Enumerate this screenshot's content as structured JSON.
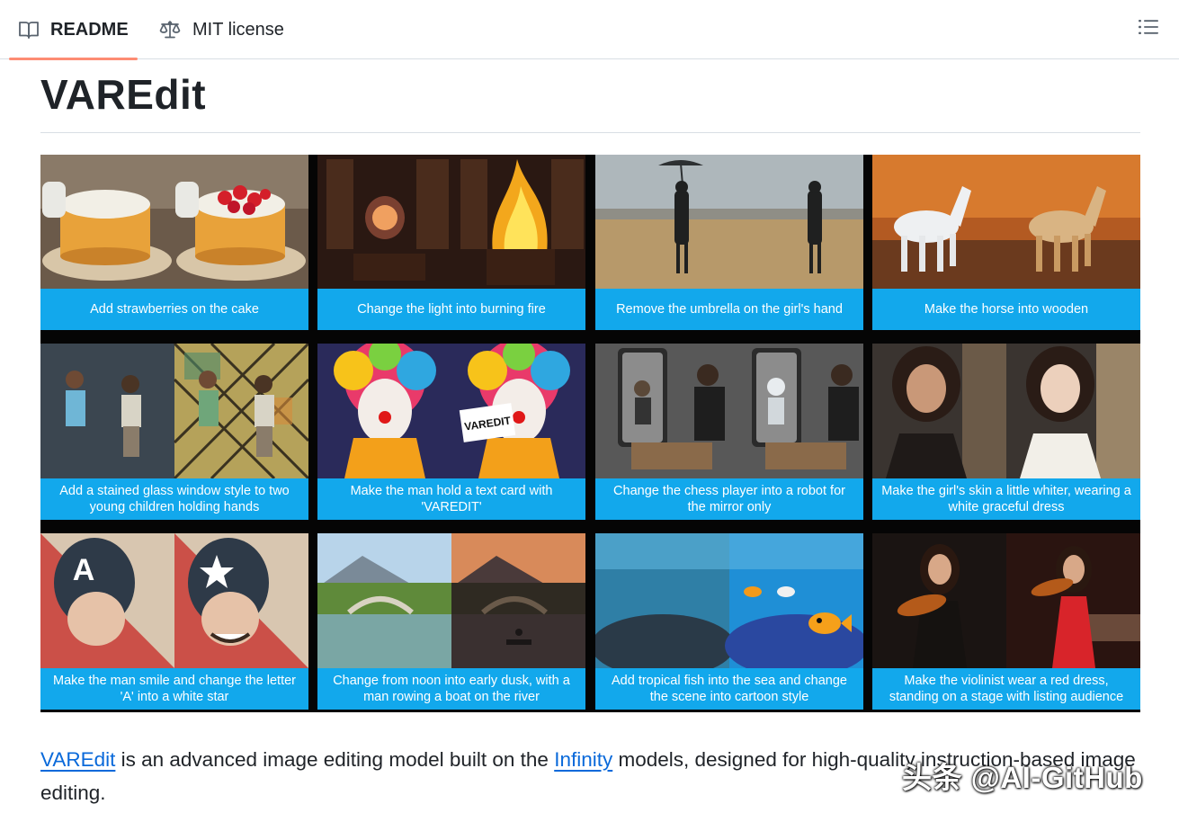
{
  "tabs": [
    {
      "label": "README",
      "icon": "book-icon",
      "active": true
    },
    {
      "label": "MIT license",
      "icon": "law-scale-icon",
      "active": false
    }
  ],
  "outline_icon": "list-outline-icon",
  "readme": {
    "title": "VAREdit",
    "teaser": {
      "caption_color": "#12a8ec",
      "items": [
        {
          "caption": "Add strawberries on the cake",
          "left": "cake",
          "right": "cake-strawberries"
        },
        {
          "caption": "Change the light into burning fire",
          "left": "lamp-library",
          "right": "fire-library"
        },
        {
          "caption": "Remove the umbrella on the girl's hand",
          "left": "girl-umbrella-field",
          "right": "girl-field"
        },
        {
          "caption": "Make the horse into wooden",
          "left": "white-horse",
          "right": "wooden-horse"
        },
        {
          "caption": "Add a stained glass window style to two young children holding hands",
          "left": "children",
          "right": "children-stained-glass"
        },
        {
          "caption": "Make the man hold a text card with 'VAREDIT'",
          "left": "clown",
          "right": "clown-card",
          "card_text": "VAREDIT"
        },
        {
          "caption": "Change the chess player into a robot for the mirror only",
          "left": "chess-mirror",
          "right": "chess-robot-mirror"
        },
        {
          "caption": "Make the girl's skin a little whiter, wearing a white graceful dress",
          "left": "girl-portrait",
          "right": "girl-white-dress"
        },
        {
          "caption": "Make the man smile and change the letter 'A' into a white star",
          "left": "comic-a",
          "right": "comic-star",
          "letter": "A"
        },
        {
          "caption": "Change from noon into early dusk, with a man rowing a boat on the river",
          "left": "bridge-noon",
          "right": "bridge-dusk"
        },
        {
          "caption": "Add tropical fish into the sea and change the scene into cartoon style",
          "left": "reef",
          "right": "reef-cartoon"
        },
        {
          "caption": "Make the violinist wear a red dress, standing on a stage with listing audience",
          "left": "violinist",
          "right": "violinist-red-stage"
        }
      ]
    },
    "paragraph": {
      "link1": "VAREdit",
      "text1": " is an advanced image editing model built on the ",
      "link2": "Infinity",
      "text2": " models, designed for high-quality instruction-based image editing."
    }
  },
  "watermark": "头条 @AI-GitHub"
}
